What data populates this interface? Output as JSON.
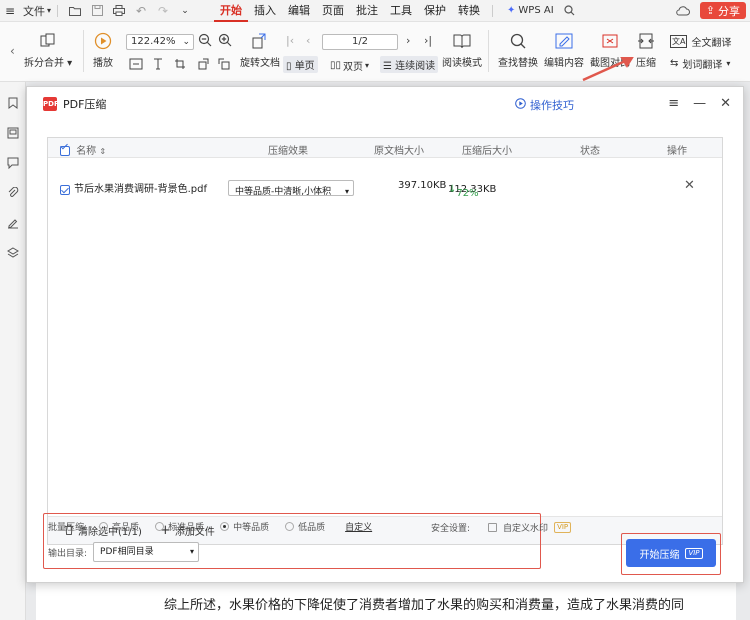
{
  "menubar": {
    "file_label": "文件",
    "tabs": [
      "开始",
      "插入",
      "编辑",
      "页面",
      "批注",
      "工具",
      "保护",
      "转换"
    ],
    "active_tab": "开始",
    "wps_ai_label": "WPS AI",
    "share_label": "分享"
  },
  "ribbon": {
    "split_merge": "拆分合并",
    "play": "播放",
    "zoom_value": "122.42%",
    "rotate": "旋转文档",
    "page_indicator": "1/2",
    "single_page": "单页",
    "double_page": "双页",
    "continuous": "连续阅读",
    "read_mode": "阅读模式",
    "find_replace": "查找替换",
    "edit_content": "编辑内容",
    "screenshot_compare": "截图对比",
    "compress": "压缩",
    "full_translate": "全文翻译",
    "word_translate": "划词翻译"
  },
  "dialog": {
    "title": "PDF压缩",
    "tips": "操作技巧",
    "headers": {
      "name": "名称",
      "effect": "压缩效果",
      "original_size": "原文档大小",
      "compressed_size": "压缩后大小",
      "status": "状态",
      "action": "操作"
    },
    "row": {
      "filename": "节后水果消费调研-背景色.pdf",
      "effect": "中等品质-中清晰,小体积",
      "original_size": "397.10KB",
      "compressed_size": "112.33KB",
      "reduction": "72%"
    },
    "footer": {
      "clear": "清除选中(1/1)",
      "add": "添加文件"
    },
    "batch_label": "批量压缩:",
    "quality_options": [
      "高品质",
      "标准品质",
      "中等品质",
      "低品质"
    ],
    "selected_quality": "中等品质",
    "custom": "自定义",
    "safety_label": "安全设置:",
    "watermark": "自定义水印",
    "vip": "VIP",
    "output_label": "输出目录:",
    "output_value": "PDF相同目录",
    "start": "开始压缩"
  },
  "document": {
    "line": "综上所述，水果价格的下降促使了消费者增加了水果的购买和消费量，造成了水果消费的同"
  },
  "colors": {
    "accent_red": "#d93025",
    "highlight_box": "#e0584d",
    "primary_blue": "#3a6ee8"
  }
}
